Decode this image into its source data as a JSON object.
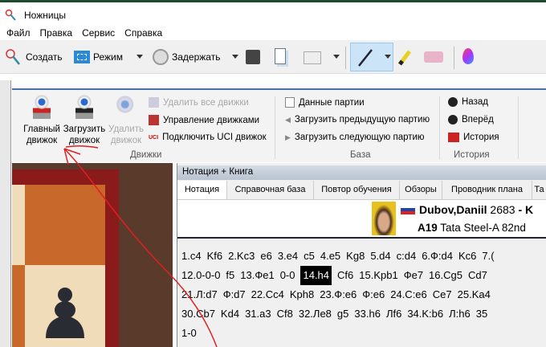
{
  "window": {
    "title": "Ножницы"
  },
  "menu": [
    "Файл",
    "Правка",
    "Сервис",
    "Справка"
  ],
  "toolbar": {
    "create": "Создать",
    "mode": "Режим",
    "delay": "Задержать"
  },
  "ribbon": {
    "engines": {
      "main_engine": "Главный движок",
      "load_engine": "Загрузить движок",
      "remove_engine": "Удалить движок",
      "remove_all": "Удалить все движки",
      "manage": "Управление движками",
      "connect_uci": "Подключить UCI движок",
      "group": "Движки"
    },
    "base": {
      "game_data": "Данные партии",
      "load_prev": "Загрузить предыдущую партию",
      "load_next": "Загрузить следующую партию",
      "group": "База"
    },
    "history": {
      "back": "Назад",
      "forward": "Вперёд",
      "history": "История",
      "group": "История"
    }
  },
  "panel": {
    "title": "Нотация + Книга",
    "tabs": [
      "Нотация",
      "Справочная база",
      "Повтор обучения",
      "Обзоры",
      "Проводник плана",
      "Та"
    ],
    "game": {
      "white": "Dubov,Daniil",
      "white_elo": "2683",
      "separator": "- K",
      "eco": "A19",
      "event": "Tata Steel-A 82nd"
    },
    "notation": [
      [
        "1.c4",
        "Kf6",
        "2.Kc3",
        "e6",
        "3.e4",
        "c5",
        "4.e5",
        "Kg8",
        "5.d4",
        "c:d4",
        "6.Ф:d4",
        "Kc6",
        "7.("
      ],
      [
        "12.0-0-0",
        "f5",
        "13.Фe1",
        "0-0",
        "14.h4",
        "Cf6",
        "15.Kpb1",
        "Фe7",
        "16.Cg5",
        "Cd7"
      ],
      [
        "21.Л:d7",
        "Ф:d7",
        "22.Cc4",
        "Kph8",
        "23.Ф:e6",
        "Ф:e6",
        "24.C:e6",
        "Ce7",
        "25.Ka4"
      ],
      [
        "30.Cb7",
        "Kd4",
        "31.a3",
        "Cf8",
        "32.Лe8",
        "g5",
        "33.h6",
        "Лf6",
        "34.K:b6",
        "Л:h6",
        "35"
      ],
      [
        "1-0"
      ]
    ],
    "current_move": "14.h4"
  },
  "colors": {
    "annotation": "#e02020",
    "ribbon_border": "#4a6fa5",
    "board_frame": "#8b1a1a"
  }
}
